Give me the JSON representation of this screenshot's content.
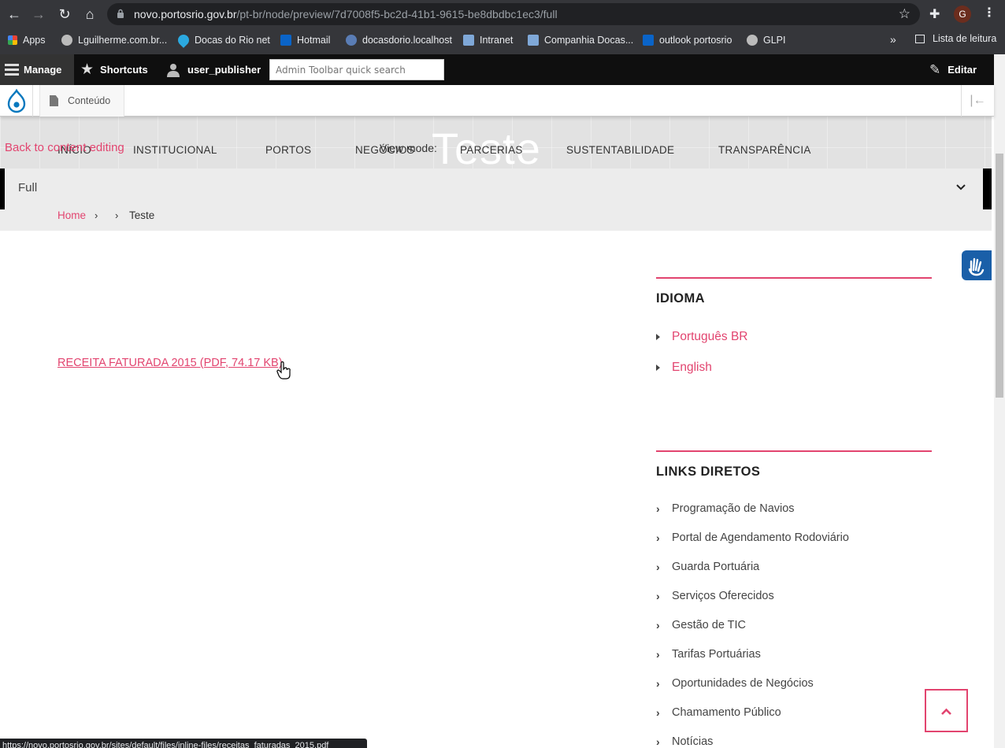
{
  "browser": {
    "url_host": "novo.portosrio.gov.br",
    "url_path": "/pt-br/node/preview/7d7008f5-bc2d-41b1-9615-be8dbdbc1ec3/full",
    "profile_initial": "G",
    "bookmarks": [
      "Apps",
      "Lguilherme.com.br...",
      "Docas do Rio net",
      "Hotmail",
      "docasdorio.localhost",
      "Intranet",
      "Companhia Docas...",
      "outlook portosrio",
      "GLPI"
    ],
    "reading_list": "Lista de leitura",
    "status_url": "https://novo.portosrio.gov.br/sites/default/files/inline-files/receitas_faturadas_2015.pdf"
  },
  "toolbar": {
    "manage": "Manage",
    "shortcuts": "Shortcuts",
    "user": "user_publisher",
    "search_placeholder": "Admin Toolbar quick search",
    "edit": "Editar",
    "tray_content": "Conteúdo"
  },
  "preview": {
    "back_link": "Back to content editing",
    "view_mode_label": "View mode:",
    "view_mode_value": "Full"
  },
  "site": {
    "page_title": "Teste",
    "nav": [
      "INÍCIO",
      "INSTITUCIONAL",
      "PORTOS",
      "NEGÓCIOS",
      "PARCERIAS",
      "SUSTENTABILIDADE",
      "TRANSPARÊNCIA"
    ],
    "breadcrumb_home": "Home",
    "breadcrumb_sep": "›",
    "breadcrumb_current": "Teste"
  },
  "main": {
    "file_link": "RECEITA FATURADA 2015 (PDF, 74.17 KB)"
  },
  "sidebar": {
    "idioma_heading": "IDIOMA",
    "languages": [
      "Português BR",
      "English"
    ],
    "links_heading": "LINKS DIRETOS",
    "links": [
      "Programação de Navios",
      "Portal de Agendamento Rodoviário",
      "Guarda Portuária",
      "Serviços Oferecidos",
      "Gestão de TIC",
      "Tarifas Portuárias",
      "Oportunidades de Negócios",
      "Chamamento Público",
      "Notícias"
    ]
  },
  "colors": {
    "accent": "#e2446f",
    "toolbar": "#0f0f0f",
    "chrome": "#35363a"
  }
}
